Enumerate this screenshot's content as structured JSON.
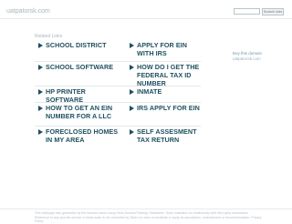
{
  "site": {
    "domain": "uatpatorsk.com"
  },
  "search": {
    "placeholder": "",
    "button_label": "Search Ads"
  },
  "main": {
    "heading": "Related Links",
    "links": [
      {
        "left": "SCHOOL DISTRICT",
        "right": "APPLY FOR EIN WITH IRS"
      },
      {
        "left": "SCHOOL SOFTWARE",
        "right": "HOW DO I GET THE FEDERAL TAX ID NUMBER"
      },
      {
        "left": "HP PRINTER SOFTWARE",
        "right": "INMATE"
      },
      {
        "left": "HOW TO GET AN EIN NUMBER FOR A LLC",
        "right": "IRS APPLY FOR EIN"
      },
      {
        "left": "FORECLOSED HOMES IN MY AREA",
        "right": "SELF ASSESMENT TAX RETURN"
      }
    ]
  },
  "sidebar": {
    "link": "Buy this domain",
    "text": "uatpatorsk.com"
  },
  "footer": {
    "text": "This webpage was generated by the domain owner using Sedo Domain Parking. Disclaimer: Sedo maintains no relationship with third party advertisers. Reference to any specific service or trade mark is not controlled by Sedo nor does it constitute or imply its association, endorsement or recommendation. Privacy Policy"
  },
  "colors": {
    "link": "#1f5060",
    "muted": "#a7b8bf"
  }
}
